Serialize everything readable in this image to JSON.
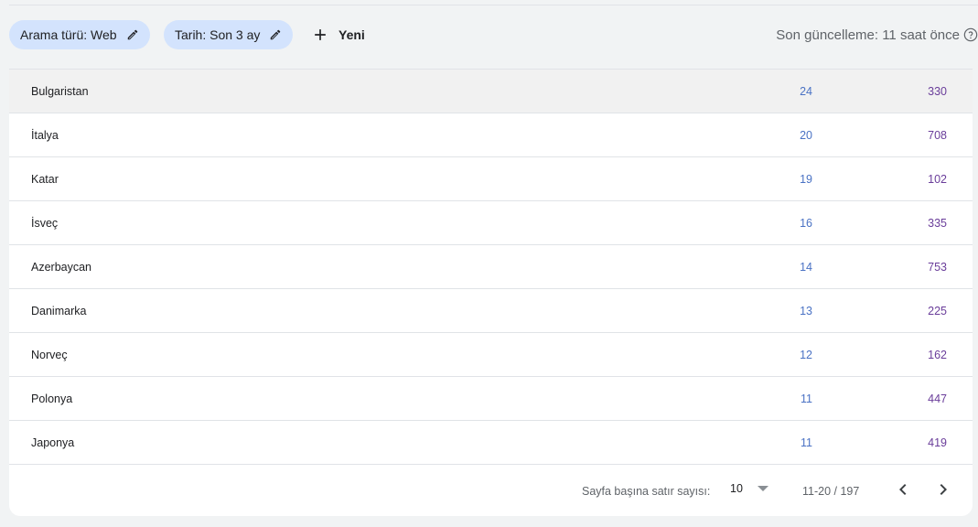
{
  "filters": {
    "search_type": "Arama türü: Web",
    "date": "Tarih: Son 3 ay",
    "new_label": "Yeni",
    "last_updated": "Son güncelleme: 11 saat önce"
  },
  "rows": [
    {
      "country": "Bulgaristan",
      "clicks": "24",
      "impressions": "330"
    },
    {
      "country": "İtalya",
      "clicks": "20",
      "impressions": "708"
    },
    {
      "country": "Katar",
      "clicks": "19",
      "impressions": "102"
    },
    {
      "country": "İsveç",
      "clicks": "16",
      "impressions": "335"
    },
    {
      "country": "Azerbaycan",
      "clicks": "14",
      "impressions": "753"
    },
    {
      "country": "Danimarka",
      "clicks": "13",
      "impressions": "225"
    },
    {
      "country": "Norveç",
      "clicks": "12",
      "impressions": "162"
    },
    {
      "country": "Polonya",
      "clicks": "11",
      "impressions": "447"
    },
    {
      "country": "Japonya",
      "clicks": "11",
      "impressions": "419"
    }
  ],
  "pagination": {
    "rows_per_page_label": "Sayfa başına satır sayısı:",
    "rows_per_page_value": "10",
    "range": "11-20 / 197"
  },
  "colors": {
    "chip_bg": "#d3e3fd",
    "clicks": "#4a72c4",
    "impressions": "#6a3d9a"
  },
  "icons": {
    "edit": "pencil-icon",
    "add": "plus-icon",
    "help": "help-circle-icon",
    "prev": "chevron-left-icon",
    "next": "chevron-right-icon"
  }
}
